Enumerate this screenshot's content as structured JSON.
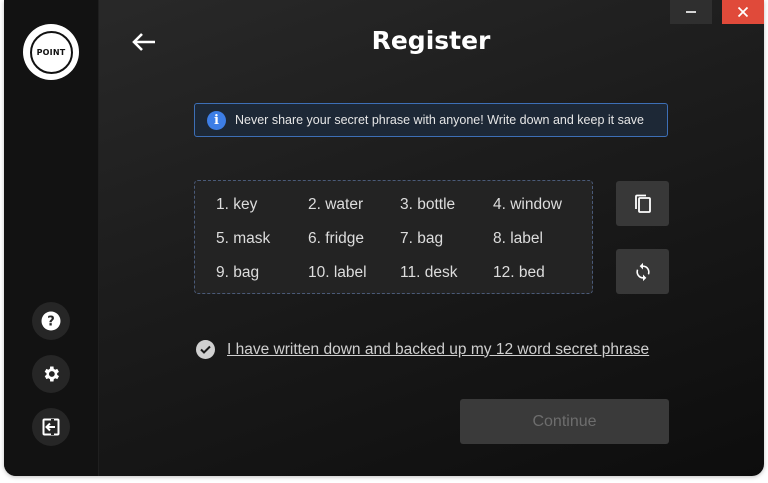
{
  "app": {
    "logo_text": "POINT"
  },
  "header": {
    "title": "Register"
  },
  "notice": {
    "icon": "info-icon",
    "text": "Never share your secret phrase with anyone! Write down and keep it save"
  },
  "phrase": {
    "words": [
      "1.  key",
      "2. water",
      "3. bottle",
      "4. window",
      "5.  mask",
      "6. fridge",
      "7. bag",
      "8. label",
      "9. bag",
      "10. label",
      "11. desk",
      "12.  bed"
    ]
  },
  "actions": {
    "copy_icon": "copy-icon",
    "refresh_icon": "refresh-icon"
  },
  "confirm": {
    "text": "I have written down and backed up my 12 word secret phrase",
    "checked": true
  },
  "continue": {
    "label": "Continue",
    "enabled": false
  },
  "sidebar": {
    "items": [
      {
        "icon": "help-icon"
      },
      {
        "icon": "gear-icon"
      },
      {
        "icon": "logout-icon"
      }
    ]
  },
  "colors": {
    "accent_blue": "#3d7ee6",
    "close_red": "#e04a3a"
  }
}
